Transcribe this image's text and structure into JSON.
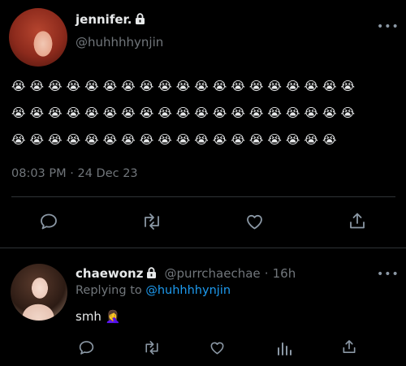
{
  "main_tweet": {
    "display_name": "jennifer.",
    "username": "@huhhhhynjin",
    "emoji_rows": [
      "😭😭😭😭😭😭😭😭😭😭😭😭😭😭😭😭😭😭😭",
      "😭😭😭😭😭😭😭😭😭😭😭😭😭😭😭😭😭😭😭",
      "😭😭😭😭😭😭😭😭😭😭😭😭😭😭😭😭😭😭"
    ],
    "timestamp": "08:03 PM · 24 Dec 23",
    "more": "•••"
  },
  "reply": {
    "display_name": "chaewonz",
    "username": "@purrchaechae",
    "separator": "·",
    "age": "16h",
    "replying_to_label": "Replying to",
    "replying_to_handle": "@huhhhhynjin",
    "text": "smh 🤦‍♀️",
    "more": "•••"
  },
  "colors": {
    "background": "#000000",
    "text": "#e7e9ea",
    "muted": "#71767b",
    "link": "#1d9bf0",
    "divider": "#2f3336"
  },
  "icons": {
    "main_actions": [
      "reply-icon",
      "retweet-icon",
      "like-icon",
      "share-icon"
    ],
    "reply_actions": [
      "reply-icon",
      "retweet-icon",
      "like-icon",
      "views-icon",
      "share-icon"
    ]
  }
}
